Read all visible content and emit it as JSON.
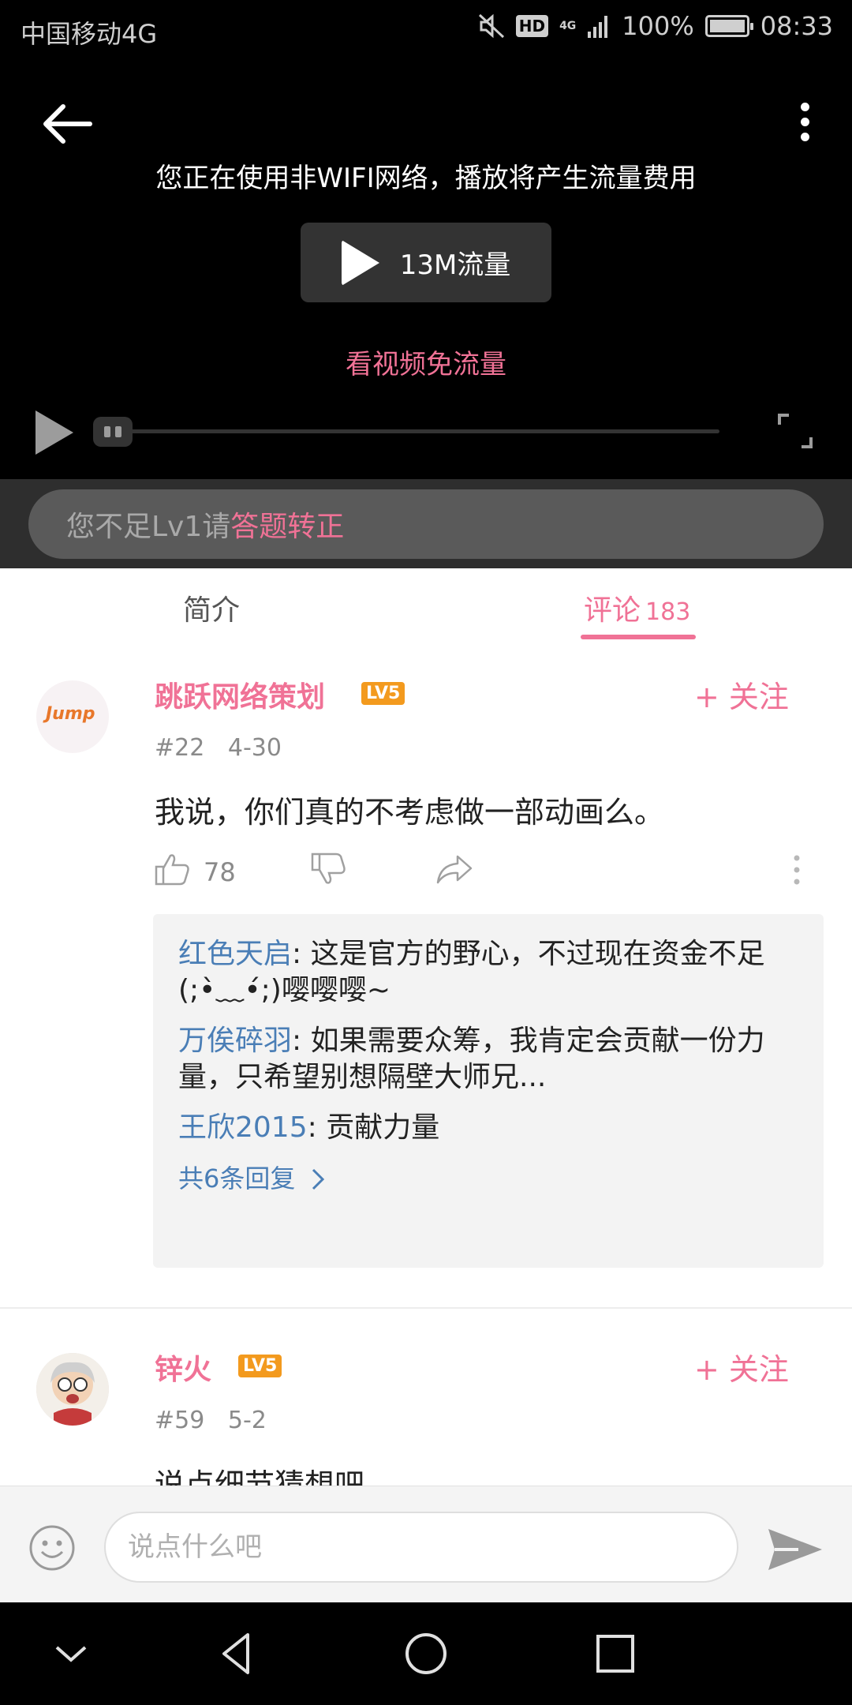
{
  "status_bar": {
    "carrier": "中国移动4G",
    "hd": "HD",
    "network": "4G",
    "battery": "100%",
    "time": "08:33"
  },
  "video": {
    "nonwifi_message": "您正在使用非WIFI网络，播放将产生流量费用",
    "play_traffic_label": "13M流量",
    "free_traffic_link": "看视频免流量"
  },
  "banner": {
    "prefix": "您不足Lv1请",
    "link": "答题转正"
  },
  "tabs": {
    "intro": "简介",
    "comments": "评论",
    "comments_count": "183"
  },
  "comments": [
    {
      "username": "跳跃网络策划",
      "level": "LV5",
      "follow": "+ 关注",
      "floor": "#22",
      "date": "4-30",
      "text": "我说，你们真的不考虑做一部动画么。",
      "likes": "78",
      "avatar_text": "Jump",
      "replies": [
        {
          "user": "红色天启",
          "text": ": 这是官方的野心，不过现在资金不足(;•̀﹏•́;)嘤嘤嘤~"
        },
        {
          "user": "万俟碎羽",
          "text": ": 如果需要众筹，我肯定会贡献一份力量，只希望别想隔壁大师兄..."
        },
        {
          "user": "王欣2015",
          "text": ": 贡献力量"
        }
      ],
      "more_replies": "共6条回复"
    },
    {
      "username": "锌火",
      "level": "LV5",
      "follow": "+ 关注",
      "floor": "#59",
      "date": "5-2",
      "text": "说点细节猜想吧"
    }
  ],
  "input": {
    "placeholder": "说点什么吧"
  },
  "colors": {
    "accent": "#f07296",
    "link_blue": "#4a7eb6",
    "level_orange": "#f39a1e"
  }
}
